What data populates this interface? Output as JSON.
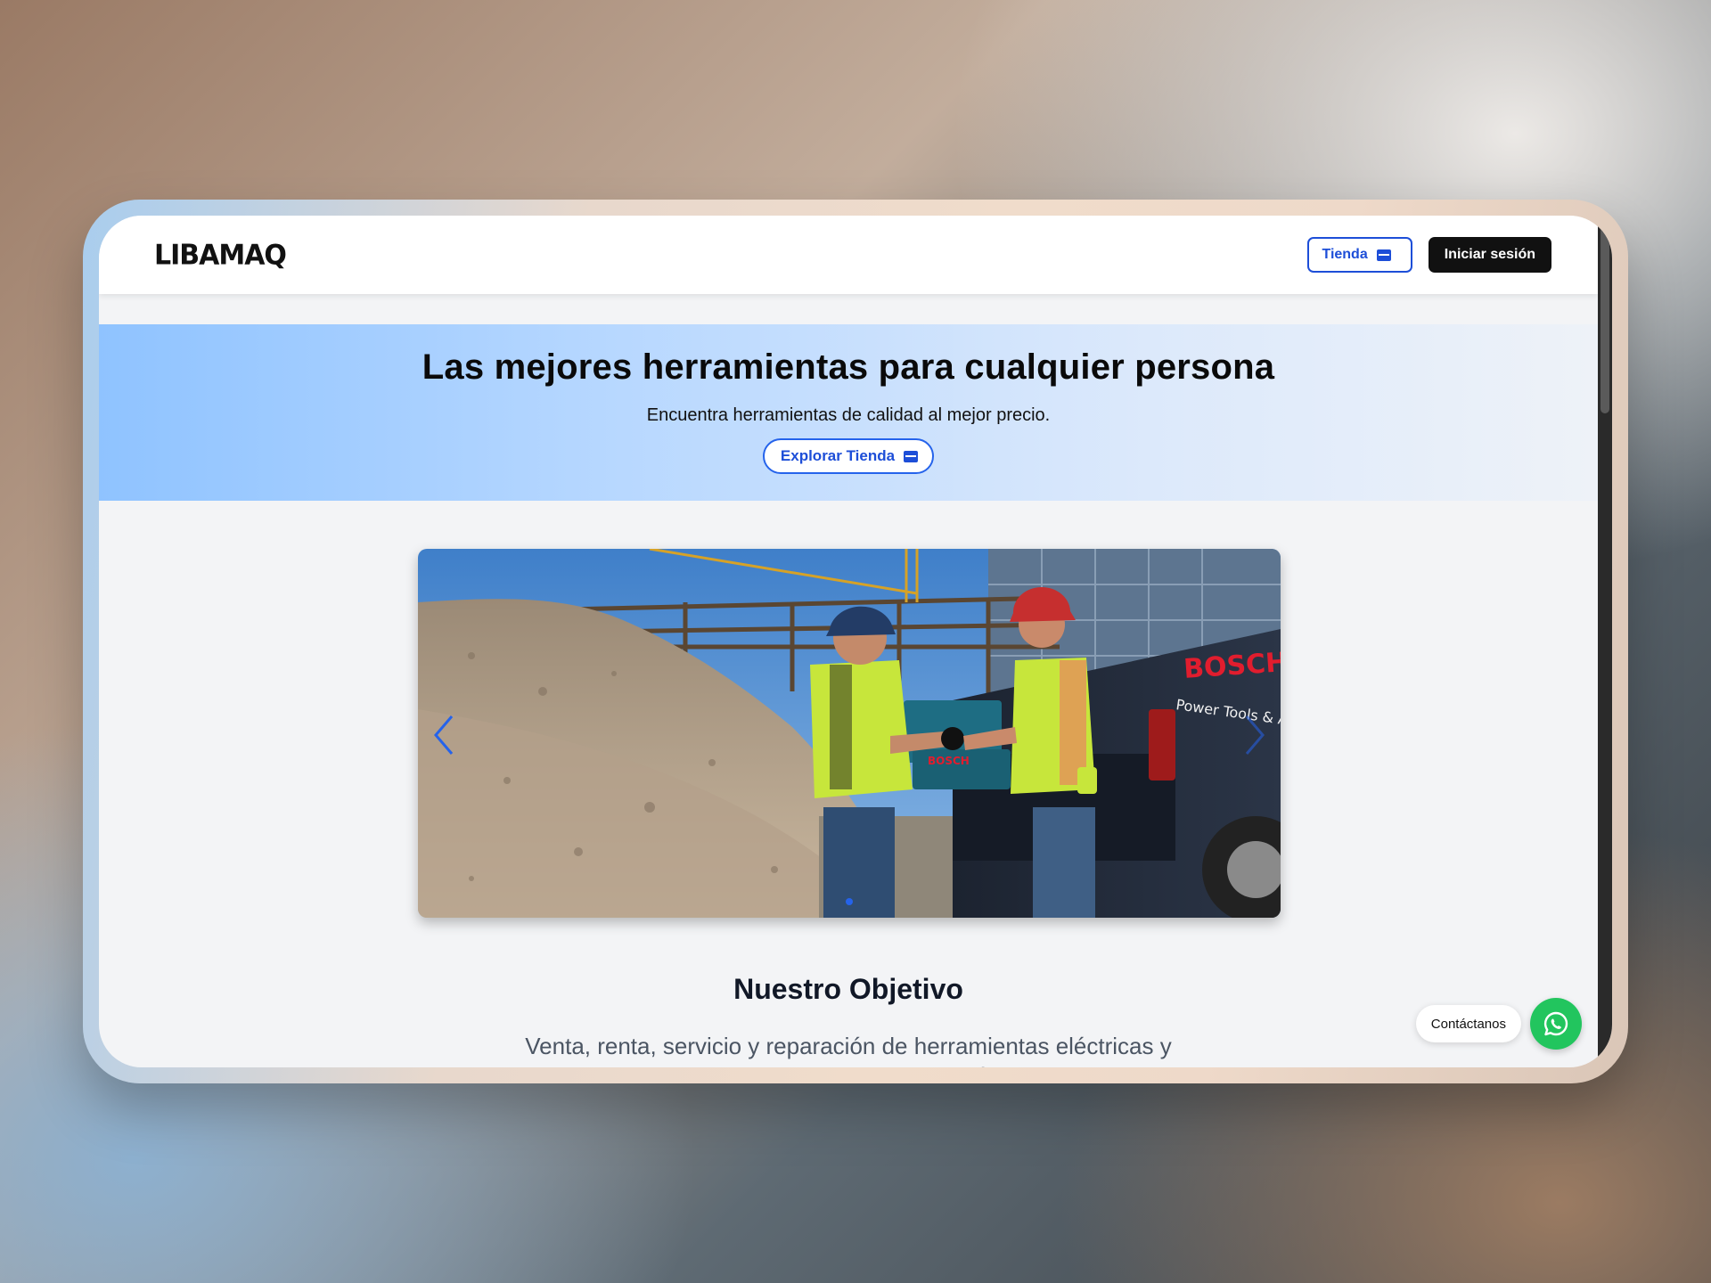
{
  "header": {
    "logo": "LIBAMAQ",
    "store_label": "Tienda",
    "login_label": "Iniciar sesión"
  },
  "hero": {
    "title": "Las mejores herramientas para cualquier persona",
    "subtitle": "Encuentra herramientas de calidad al mejor precio.",
    "cta_label": "Explorar Tienda"
  },
  "carousel": {
    "image_text_brand": "BOSCH",
    "image_text_tagline": "Power Tools & Acc",
    "prev_icon": "chevron-left-icon",
    "next_icon": "chevron-right-icon",
    "active_slide": 1
  },
  "objective": {
    "title": "Nuestro Objetivo",
    "text": "Venta, renta, servicio y reparación de herramientas eléctricas y maquinaria para construcción"
  },
  "contact": {
    "label": "Contáctanos",
    "icon": "whatsapp-icon"
  },
  "colors": {
    "accent": "#1d4ed8",
    "whatsapp": "#22c55e",
    "dark_button": "#111111"
  }
}
